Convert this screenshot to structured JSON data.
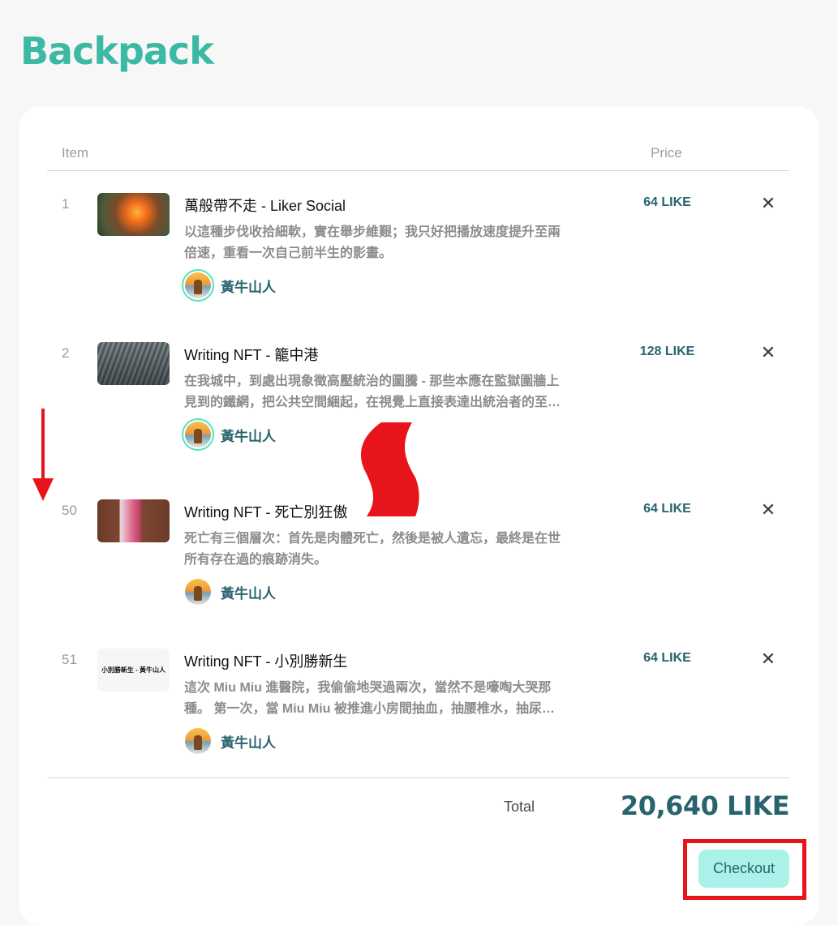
{
  "page": {
    "title": "Backpack"
  },
  "table": {
    "header_item": "Item",
    "header_price": "Price"
  },
  "items": [
    {
      "index": "1",
      "thumb_text": "",
      "title": "萬般帶不走 - Liker Social",
      "desc_line1": "以這種步伐收拾細軟，實在舉步維艱；我只好把播放速度提升至兩",
      "desc_line2": "倍速，重看一次自己前半生的影畫。",
      "author": "黃牛山人",
      "price": "64 LIKE"
    },
    {
      "index": "2",
      "thumb_text": "",
      "title": "Writing NFT - 籠中港",
      "desc_line1": "在我城中，到處出現象徵高壓統治的圖騰 - 那些本應在監獄圍牆上",
      "desc_line2": "見到的鐵網，把公共空間綑起，在視覺上直接表達出統治者的至…",
      "author": "黃牛山人",
      "price": "128 LIKE"
    },
    {
      "index": "50",
      "thumb_text": "",
      "title": "Writing NFT - 死亡別狂傲",
      "desc_line1": "死亡有三個層次：首先是肉體死亡，然後是被人遺忘，最終是在世",
      "desc_line2": "所有存在過的痕跡消失。",
      "author": "黃牛山人",
      "price": "64 LIKE"
    },
    {
      "index": "51",
      "thumb_text": "小別勝新生 - 黃牛山人",
      "title": "Writing NFT - 小別勝新生",
      "desc_line1": "這次 Miu Miu 進醫院，我偷偷地哭過兩次，當然不是嚎啕大哭那",
      "desc_line2": "種。 第一次，當 Miu Miu 被推進小房間抽血，抽腰椎水，抽尿…",
      "author": "黃牛山人",
      "price": "64 LIKE"
    }
  ],
  "remove_glyph": "✕",
  "footer": {
    "total_label": "Total",
    "total_value": "20,640 LIKE",
    "checkout_label": "Checkout"
  },
  "colors": {
    "brand": "#3bb9a4",
    "price_text": "#28646e",
    "checkout_bg": "#aaf1e7",
    "annotation_red": "#e8141c"
  }
}
